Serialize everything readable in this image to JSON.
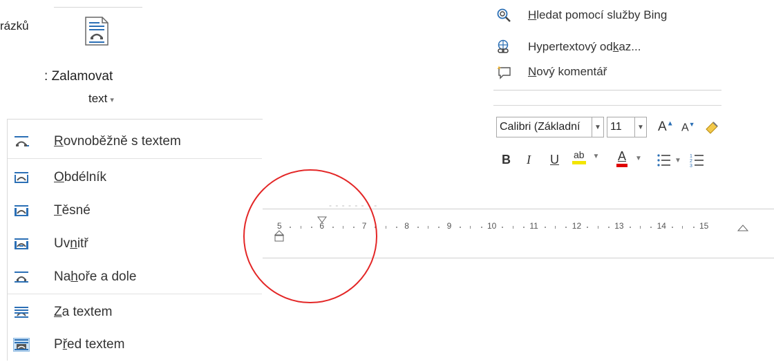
{
  "ribbon": {
    "partial_text": "rázků",
    "wrap_button": {
      "label_line1": "Zalamovat",
      "label_prefix": ":",
      "label_line2": "text",
      "caret": "▾",
      "icon": "wrap-text-icon"
    }
  },
  "wrap_menu": {
    "items": [
      {
        "label_pre": "",
        "label_u": "R",
        "label_post": "ovnoběžně s textem",
        "icon": "in-line-with-text-icon"
      },
      {
        "label_pre": "",
        "label_u": "O",
        "label_post": "bdélník",
        "icon": "square-wrap-icon"
      },
      {
        "label_pre": "",
        "label_u": "T",
        "label_post": "ěsné",
        "icon": "tight-wrap-icon"
      },
      {
        "label_pre": "Uv",
        "label_u": "n",
        "label_post": "itř",
        "icon": "through-wrap-icon"
      },
      {
        "label_pre": "Na",
        "label_u": "h",
        "label_post": "oře a dole",
        "icon": "top-bottom-wrap-icon"
      },
      {
        "label_pre": "",
        "label_u": "Z",
        "label_post": "a textem",
        "icon": "behind-text-icon"
      },
      {
        "label_pre": "P",
        "label_u": "ř",
        "label_post": "ed textem",
        "icon": "in-front-of-text-icon"
      }
    ]
  },
  "context_menu": {
    "items": [
      {
        "label_pre": "",
        "label_u": "H",
        "label_post": "ledat pomocí služby Bing",
        "icon": "search-bing-icon"
      },
      {
        "label_pre": "Hypertextový od",
        "label_u": "k",
        "label_post": "az...",
        "icon": "hyperlink-icon"
      },
      {
        "label_pre": "",
        "label_u": "N",
        "label_post": "ový komentář",
        "icon": "new-comment-icon"
      }
    ]
  },
  "mini_toolbar": {
    "font_name": "Calibri (Základní",
    "font_size": "11",
    "grow_font": "A",
    "shrink_font": "A",
    "bold": "B",
    "italic": "I",
    "underline": "U",
    "highlight": "ab",
    "font_color": "A",
    "colors": {
      "highlight": "#f3e500",
      "font_color": "#e00000"
    }
  },
  "ruler": {
    "labels": [
      "5",
      "6",
      "7",
      "8",
      "9",
      "10",
      "11",
      "12",
      "13",
      "14",
      "15"
    ]
  },
  "colors": {
    "annotation_circle": "#e32626"
  }
}
